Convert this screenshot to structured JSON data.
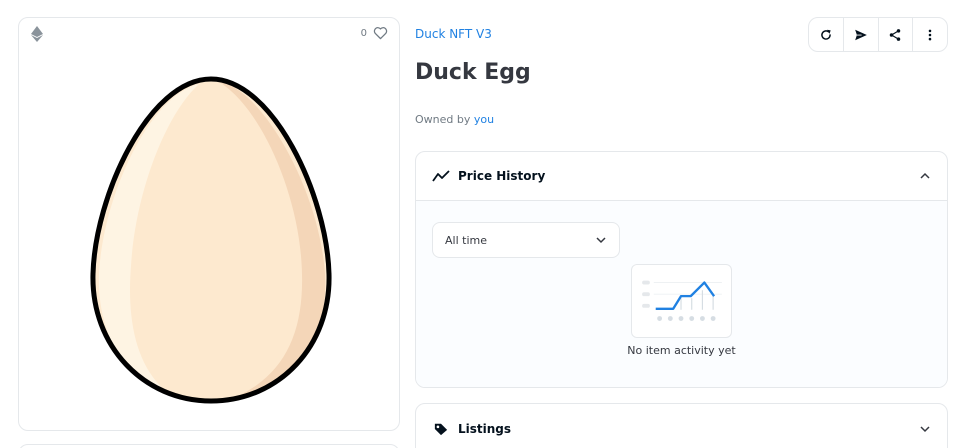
{
  "media": {
    "favorite_count": "0"
  },
  "item": {
    "collection": "Duck NFT V3",
    "title": "Duck Egg",
    "owned_by_prefix": "Owned by ",
    "owner": "you"
  },
  "actions": [
    {
      "icon": "refresh-icon"
    },
    {
      "icon": "send-icon"
    },
    {
      "icon": "share-icon"
    },
    {
      "icon": "more-icon"
    }
  ],
  "price_history": {
    "title": "Price History",
    "filter_value": "All time",
    "empty_text": "No item activity yet"
  },
  "listings": {
    "title": "Listings"
  },
  "colors": {
    "accent": "#2081e2",
    "egg_fill": "#fde9cf",
    "egg_shadow": "#f4d6b8"
  }
}
